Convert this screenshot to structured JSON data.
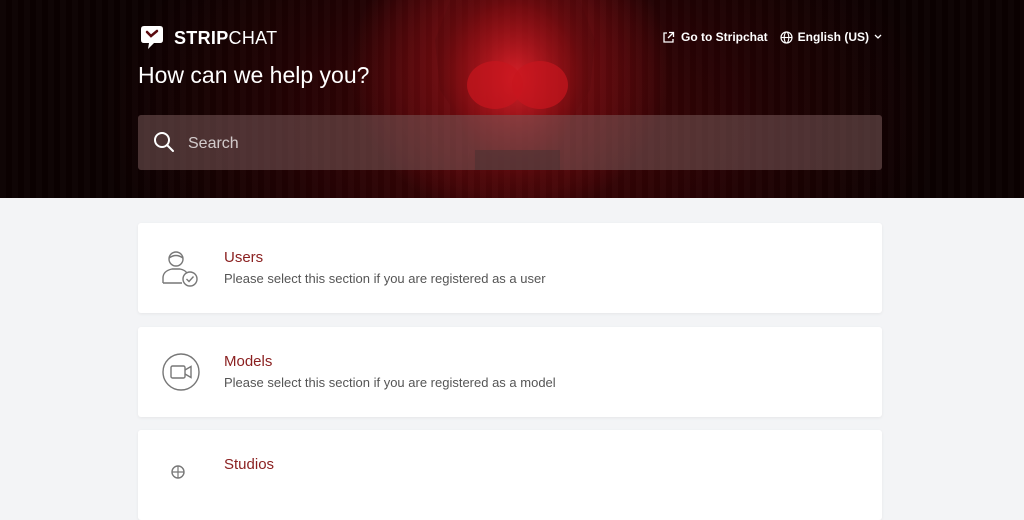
{
  "brand": {
    "name_bold": "STRIP",
    "name_light": "CHAT"
  },
  "nav": {
    "goto_label": "Go to Stripchat",
    "language_label": "English (US)"
  },
  "hero": {
    "title": "How can we help you?",
    "search_placeholder": "Search"
  },
  "sections": [
    {
      "title": "Users",
      "description": "Please select this section if you are registered as a user",
      "icon": "user-check-icon"
    },
    {
      "title": "Models",
      "description": "Please select this section if you are registered as a model",
      "icon": "video-camera-icon"
    },
    {
      "title": "Studios",
      "description": "",
      "icon": "studio-icon"
    }
  ],
  "colors": {
    "accent_title": "#8a1f1f",
    "hero_red": "#b3121a",
    "background": "#f3f4f6"
  }
}
